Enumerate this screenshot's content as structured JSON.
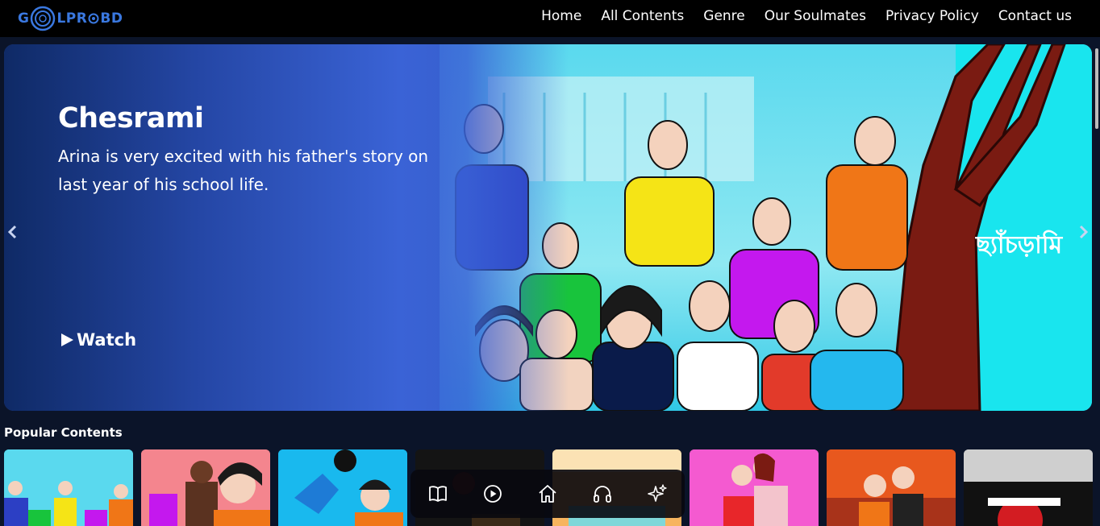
{
  "header": {
    "logo_text_left": "G",
    "logo_text_mid": "LPR",
    "logo_text_right": "BD",
    "nav": [
      {
        "label": "Home"
      },
      {
        "label": "All Contents"
      },
      {
        "label": "Genre"
      },
      {
        "label": "Our Soulmates"
      },
      {
        "label": "Privacy Policy"
      },
      {
        "label": "Contact us"
      }
    ]
  },
  "hero": {
    "title": "Chesrami",
    "description": "Arina is very excited with his father's story on last year of his school life.",
    "watch_label": "Watch",
    "watch_icon": "play-triangle-icon",
    "art_title": "ছ্যাঁচড়ামি",
    "prev_icon": "chevron-left-icon",
    "next_icon": "chevron-right-icon"
  },
  "popular": {
    "title": "Popular Contents",
    "cards": [
      {
        "id": "c1",
        "bg": "#37d4f0"
      },
      {
        "id": "c2",
        "bg": "#f07a84"
      },
      {
        "id": "c3",
        "bg": "#19b9ee"
      },
      {
        "id": "c4",
        "bg": "#141414"
      },
      {
        "id": "c5",
        "bg": "#f4a24a"
      },
      {
        "id": "c6",
        "bg": "#f060c8"
      },
      {
        "id": "c7",
        "bg": "#e8581e"
      },
      {
        "id": "c8",
        "bg": "#d9d9d9"
      }
    ]
  },
  "dock": {
    "items": [
      {
        "icon": "book-icon"
      },
      {
        "icon": "play-circle-icon"
      },
      {
        "icon": "home-icon"
      },
      {
        "icon": "headphones-icon"
      },
      {
        "icon": "sparkles-icon"
      }
    ]
  },
  "colors": {
    "brand_blue": "#3a78e0",
    "header_bg": "#000000",
    "page_bg": "#0b1429",
    "hero_blue": "#3a63d6"
  }
}
